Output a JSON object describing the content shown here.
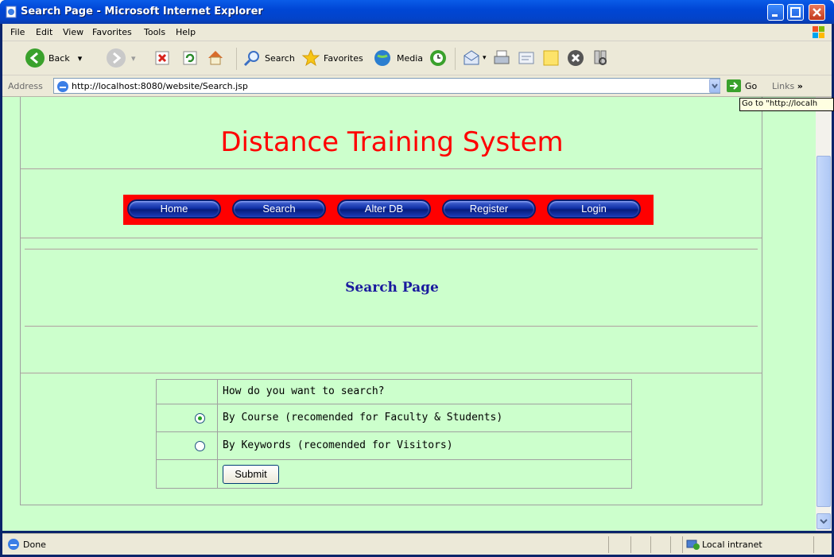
{
  "window": {
    "title": "Search Page - Microsoft Internet Explorer"
  },
  "menu": [
    "File",
    "Edit",
    "View",
    "Favorites",
    "Tools",
    "Help"
  ],
  "toolbar": {
    "back": "Back",
    "search": "Search",
    "favorites": "Favorites",
    "media": "Media"
  },
  "address": {
    "label": "Address",
    "url": "http://localhost:8080/website/Search.jsp",
    "go": "Go",
    "links": "Links",
    "tooltip": "Go to \"http://localh"
  },
  "page": {
    "title": "Distance Training System",
    "nav": [
      "Home",
      "Search",
      "Alter DB",
      "Register",
      "Login"
    ],
    "heading": "Search Page",
    "form": {
      "question": "How do you want to search?",
      "options": [
        {
          "label": "By Course (recomended for Faculty & Students)",
          "selected": true
        },
        {
          "label": "By Keywords (recomended for Visitors)",
          "selected": false
        }
      ],
      "submit": "Submit"
    }
  },
  "status": {
    "text": "Done",
    "zone": "Local intranet"
  },
  "colors": {
    "page_bg": "#ccffcc",
    "title": "#ff0000",
    "nav_bar": "#ff0000",
    "heading": "#1a1a9e"
  }
}
